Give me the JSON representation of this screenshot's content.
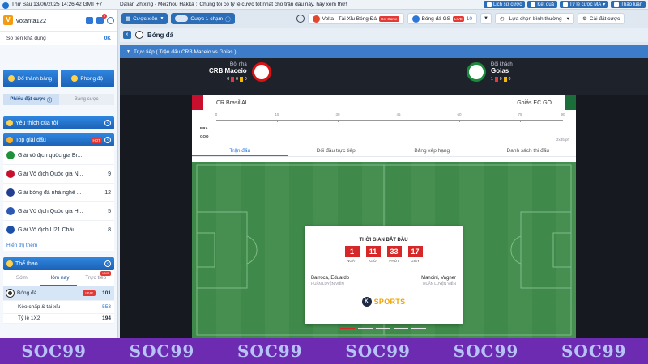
{
  "topbar": {
    "clock": "Thứ Sáu 13/06/2025 14:26:42 GMT +7",
    "marquee_a": "Dalian Zhixing - Meizhou Hakka :",
    "marquee_b": "Chúng tôi có tỷ lệ cược tốt nhất cho trận đấu này, hãy xem thử!",
    "buttons": [
      "Lịch sử cược",
      "Kết quả",
      "Tỷ lệ cược MA",
      "Thảo luận"
    ]
  },
  "user": {
    "name": "votanta122",
    "badge": "1",
    "balance_label": "Số tiền khả dụng",
    "balance_value": "0K"
  },
  "quick": [
    "Đổ thành bảng",
    "Phong độ"
  ],
  "bettabs": [
    "Phiếu đặt cược",
    "Bảng cược"
  ],
  "sections": {
    "favorites": "Yêu thích của tôi",
    "top": "Top giải đấu",
    "top_badge": "HOT",
    "sports": "Thể thao"
  },
  "leagues": [
    {
      "name": "Giải vô địch quốc gia Br...",
      "count": "",
      "color": "#1e8f3a"
    },
    {
      "name": "Giải Vô địch Quốc gia N...",
      "count": "9",
      "color": "#c8102e"
    },
    {
      "name": "Giải bóng đá nhà nghề ...",
      "count": "12",
      "color": "#223e91"
    },
    {
      "name": "Giải Vô địch Quốc gia H...",
      "count": "5",
      "color": "#2b57b5"
    },
    {
      "name": "Giải Vô địch U21 Châu ...",
      "count": "8",
      "color": "#1d4fa8"
    }
  ],
  "more_label": "Hiển thị thêm",
  "sporttabs": [
    {
      "label": "Sớm",
      "badge": ""
    },
    {
      "label": "Hôm nay",
      "badge": ""
    },
    {
      "label": "Trực tiếp",
      "badge": "LIVE"
    }
  ],
  "sport_rows": [
    {
      "label": "Bóng đá",
      "badge": "LIVE",
      "count": "101"
    },
    {
      "label": "Kèo chấp & tài xỉu",
      "count": "553"
    },
    {
      "label": "Tỷ lệ 1X2",
      "count": "194"
    }
  ],
  "toolbar": {
    "bet_btn": "Cược xiên",
    "one_click": "Cược 1 chạm",
    "game1": "Volta - Tài Xỉu Bóng Đá",
    "game1_tag": "Hot Game",
    "game2": "Bóng đá GS",
    "game2_tag": "LIVE",
    "game2_count": "10",
    "sort": "Lựa chọn bình thường",
    "settings": "Cài đặt cược"
  },
  "breadcrumb": "Bóng đá",
  "livebar": "Trực tiếp ( Trận đấu CRB Maceio vs Goias )",
  "match": {
    "home_role": "Đội nhà",
    "home_name": "CRB Maceio",
    "home_cards": [
      "0",
      "0",
      "0"
    ],
    "away_role": "Đội khách",
    "away_name": "Goias",
    "away_cards": [
      "1",
      "0",
      "0"
    ]
  },
  "panel": {
    "home_full": "CR Brasil AL",
    "away_full": "Goiás EC GO",
    "tl_home": "BRA",
    "tl_away": "GOO",
    "ticks": [
      "0",
      "15",
      "30",
      "45",
      "60",
      "75",
      "90"
    ],
    "extra": "2x45 ph",
    "tabs": [
      "Trận đấu",
      "Đối đầu trực tiếp",
      "Bảng xếp hạng",
      "Danh sách thi đấu"
    ]
  },
  "card": {
    "title": "THỜI GIAN BẮT ĐẦU",
    "countdown": [
      {
        "value": "1",
        "unit": "NGÀY"
      },
      {
        "value": "11",
        "unit": "GIỜ"
      },
      {
        "value": "33",
        "unit": "PHÚT"
      },
      {
        "value": "17",
        "unit": "GIÂY"
      }
    ],
    "coach_home": "Barroca, Eduardo",
    "coach_home_role": "HUẤN LUYỆN VIÊN",
    "coach_away": "Mancini, Vagner",
    "coach_away_role": "HUẤN LUYỆN VIÊN",
    "brand": "SPORTS",
    "brand_k": "K"
  },
  "watermark": [
    "SOC99",
    "SOC99",
    "SOC99",
    "SOC99",
    "SOC99",
    "SOC99"
  ]
}
